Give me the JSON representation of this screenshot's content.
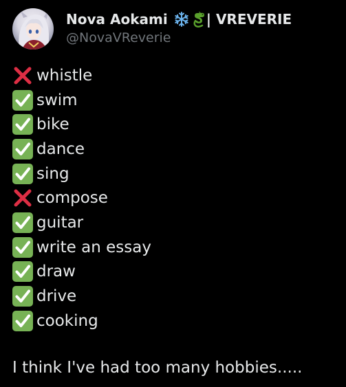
{
  "user": {
    "display_name": "Nova Aokami",
    "name_suffix": "| VREVERIE",
    "handle": "@NovaVReverie"
  },
  "list": [
    {
      "mark": "cross-icon",
      "text": "whistle"
    },
    {
      "mark": "check-icon",
      "text": "swim"
    },
    {
      "mark": "check-icon",
      "text": "bike"
    },
    {
      "mark": "check-icon",
      "text": "dance"
    },
    {
      "mark": "check-icon",
      "text": "sing"
    },
    {
      "mark": "cross-icon",
      "text": "compose"
    },
    {
      "mark": "check-icon",
      "text": "guitar"
    },
    {
      "mark": "check-icon",
      "text": "write an essay"
    },
    {
      "mark": "check-icon",
      "text": "draw"
    },
    {
      "mark": "check-icon",
      "text": "drive"
    },
    {
      "mark": "check-icon",
      "text": "cooking"
    }
  ],
  "footer_text": "I think I've had too many hobbies.....",
  "colors": {
    "background": "#000000",
    "text": "#e7e9ea",
    "muted": "#71767b",
    "check_bg": "#77b255",
    "cross": "#dd2e44"
  }
}
